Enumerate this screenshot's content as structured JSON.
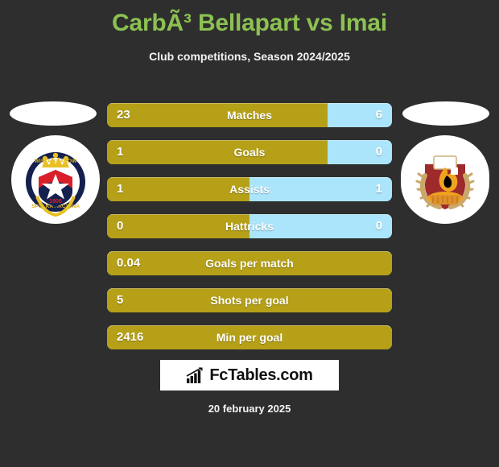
{
  "header": {
    "title": "CarbÃ³ Bellapart vs Imai",
    "subtitle": "Club competitions, Season 2024/2025",
    "title_color": "#8cc152"
  },
  "theme": {
    "background": "#2e2e2e",
    "home_color": "#b5a017",
    "away_color": "#aae5fb",
    "text_color": "#ffffff"
  },
  "teams": {
    "home": {
      "crest_name": "wisla-krakow-crest",
      "crest_year": "1906"
    },
    "away": {
      "crest_name": "flame-laurel-crest"
    }
  },
  "stats": [
    {
      "label": "Matches",
      "home": "23",
      "away": "6",
      "home_pct": 77.5,
      "split": true
    },
    {
      "label": "Goals",
      "home": "1",
      "away": "0",
      "home_pct": 77.5,
      "split": true
    },
    {
      "label": "Assists",
      "home": "1",
      "away": "1",
      "home_pct": 50.0,
      "split": true
    },
    {
      "label": "Hattricks",
      "home": "0",
      "away": "0",
      "home_pct": 50.0,
      "split": true
    },
    {
      "label": "Goals per match",
      "home": "0.04",
      "away": "",
      "home_pct": 100,
      "split": false
    },
    {
      "label": "Shots per goal",
      "home": "5",
      "away": "",
      "home_pct": 100,
      "split": false
    },
    {
      "label": "Min per goal",
      "home": "2416",
      "away": "",
      "home_pct": 100,
      "split": false
    }
  ],
  "footer": {
    "brand": "FcTables.com",
    "brand_icon": "bar-chart-icon",
    "date": "20 february 2025"
  }
}
